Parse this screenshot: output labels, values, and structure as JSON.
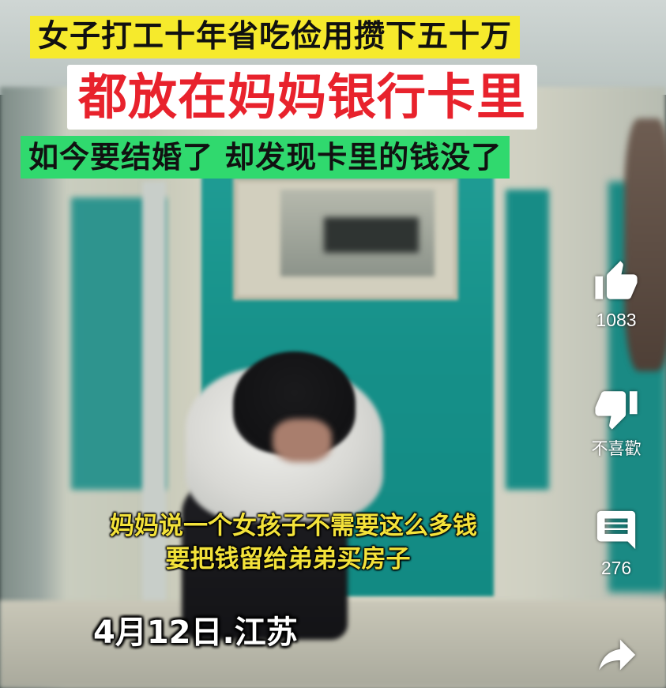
{
  "banners": {
    "line1": "女子打工十年省吃俭用攒下五十万",
    "line2": "都放在妈妈银行卡里",
    "line3": "如今要结婚了 却发现卡里的钱没了"
  },
  "subtitles": {
    "line1": "妈妈说一个女孩子不需要这么多钱",
    "line2": "要把钱留给弟弟买房子"
  },
  "date_caption": "4月12日.江苏",
  "actions": {
    "like": {
      "icon": "thumbs-up-icon",
      "label": "1083"
    },
    "dislike": {
      "icon": "thumbs-down-icon",
      "label": "不喜歡"
    },
    "comment": {
      "icon": "comment-icon",
      "label": "276"
    },
    "share": {
      "icon": "share-arrow-icon"
    }
  },
  "colors": {
    "banner1_bg": "#f6ea2c",
    "banner2_bg": "#ffffff",
    "banner2_text": "#e8222c",
    "banner3_bg": "#30d96e",
    "subtitle_text": "#f3e23a"
  }
}
